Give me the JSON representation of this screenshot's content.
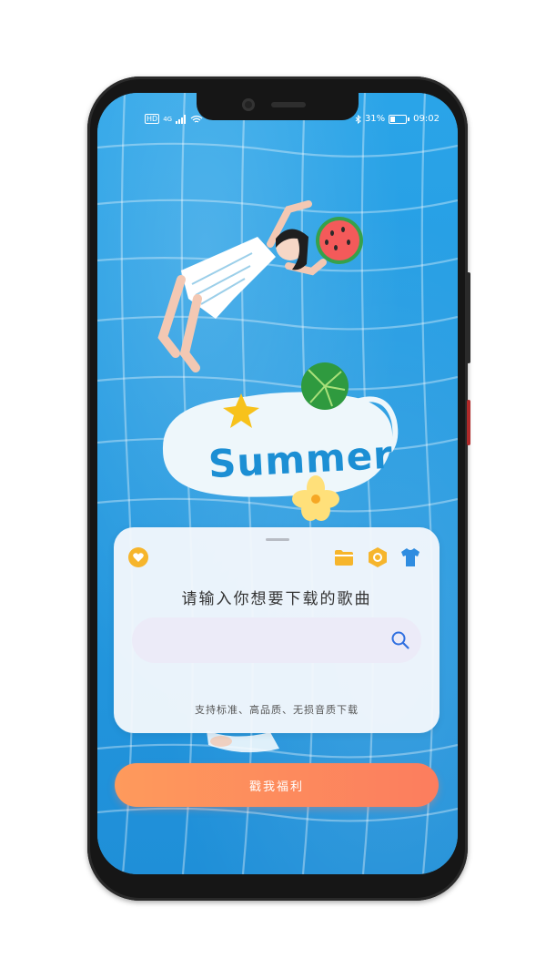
{
  "status_bar": {
    "left_badges": [
      "HD",
      "4G"
    ],
    "battery": "31%",
    "time": "09:02"
  },
  "hero": {
    "title": "Summer"
  },
  "card": {
    "title": "请输入你想要下载的歌曲",
    "search_placeholder": "",
    "footer": "支持标准、高品质、无损音质下载",
    "icons": [
      "heart-icon",
      "folder-icon",
      "hexagon-icon",
      "shirt-icon",
      "search-icon"
    ]
  },
  "cta": {
    "label": "戳我福利"
  },
  "colors": {
    "pool": "#2aa4e8",
    "card_bg": "#f4f8fc",
    "search_bg": "#ecebf8",
    "accent_yellow": "#f6b52c",
    "accent_blue": "#2f8ce0",
    "cta_start": "#fe9a5c",
    "cta_end": "#fc7d5e"
  }
}
